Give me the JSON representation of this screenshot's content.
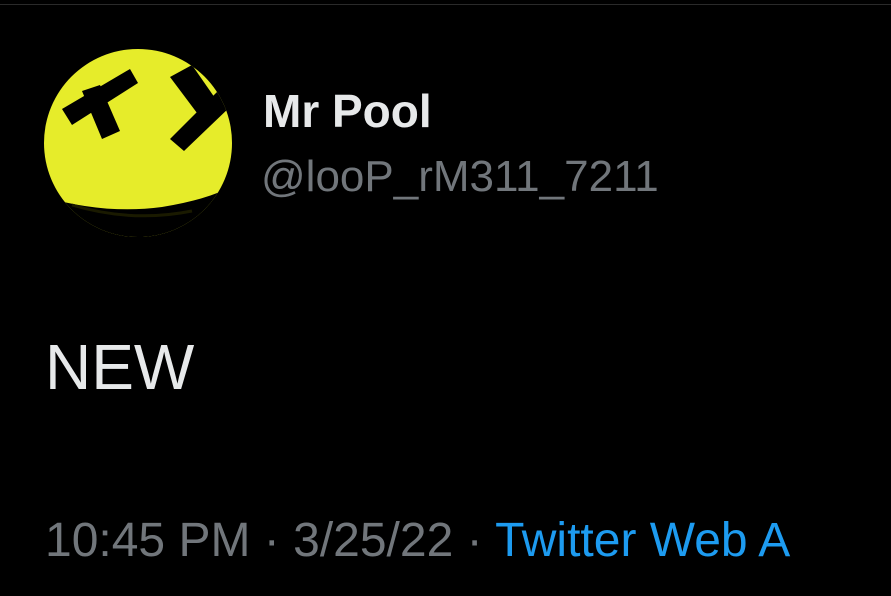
{
  "tweet": {
    "author": {
      "display_name": "Mr Pool",
      "handle": "@looP_rM311_7211",
      "avatar_icon": "yellow-face-avatar-icon"
    },
    "text": "NEW",
    "meta": {
      "time": "10:45 PM",
      "separator": "·",
      "date": "3/25/22",
      "source": "Twitter Web A"
    }
  },
  "colors": {
    "background": "#000000",
    "primary_text": "#e7e9ea",
    "secondary_text": "#71767b",
    "link": "#1d9bf0",
    "avatar_yellow": "#e6ec2a"
  }
}
